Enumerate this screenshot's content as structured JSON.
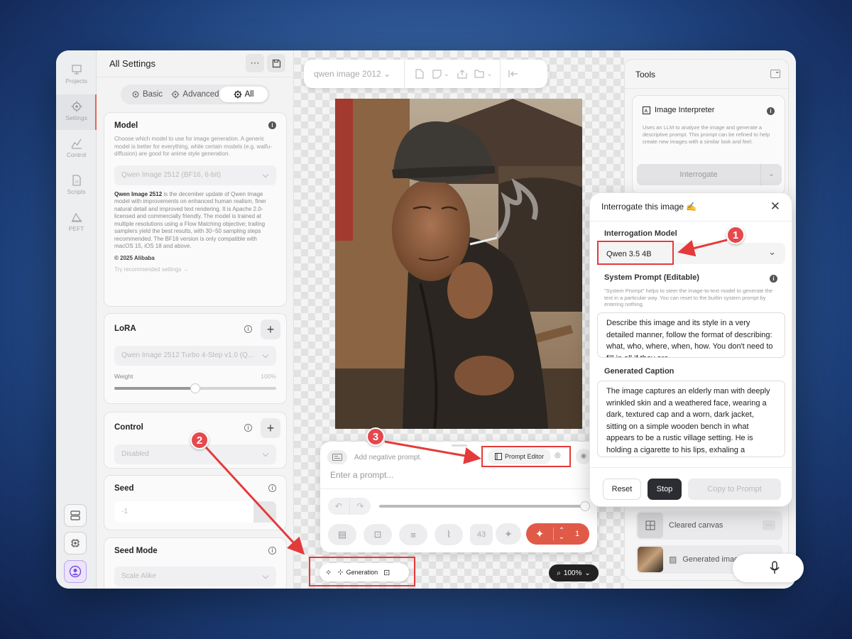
{
  "rail": {
    "items": [
      {
        "label": "Projects",
        "icon": "projects-icon"
      },
      {
        "label": "Settings",
        "icon": "settings-icon"
      },
      {
        "label": "Control",
        "icon": "control-icon"
      },
      {
        "label": "Scripts",
        "icon": "scripts-icon"
      },
      {
        "label": "PEFT",
        "icon": "peft-icon"
      }
    ],
    "active": "Settings"
  },
  "settings": {
    "title": "All Settings",
    "more_label": "⋯",
    "tabs": [
      {
        "label": "Basic"
      },
      {
        "label": "Advanced"
      },
      {
        "label": "All"
      }
    ],
    "active_tab": "All",
    "model": {
      "title": "Model",
      "description": "Choose which model to use for image generation. A generic model is better for everything, while certain models (e.g. waifu-diffusion) are good for anime style generation.",
      "value": "Qwen Image 2512 (BF16, 6-bit)",
      "detail_bold": "Qwen Image 2512",
      "detail_rest": " is the december update of Qwen Image model with improvements on enhanced human realism, finer natural detail and improved text rendering. It is Apache 2.0-licensed and commercially friendly. The model is trained at multiple resolutions using a Flow Matching objective; trailing samplers yield the best results, with 30~50 sampling steps recommended. The BF16 version is only compatible with macOS 15, iOS 18 and above.",
      "copyright": "© 2025 Alibaba",
      "recommend_link": "Try recommended settings →"
    },
    "lora": {
      "title": "LoRA",
      "value": "Qwen Image 2512 Turbo 4-Step v1.0 (Q...",
      "weight_label": "Weight",
      "weight_value": "100%",
      "weight_fraction": 0.5
    },
    "control": {
      "title": "Control",
      "value": "Disabled"
    },
    "seed": {
      "title": "Seed",
      "value": "-1"
    },
    "seed_mode": {
      "title": "Seed Mode",
      "value": "Scale Alike"
    }
  },
  "canvas": {
    "project_name": "qwen image 2012",
    "negative_prompt_placeholder": "Add negative prompt.",
    "prompt_editor_label": "Prompt Editor",
    "prompt_placeholder": "Enter a prompt...",
    "token_count": "43",
    "batch_count": "1",
    "mode_label": "Generation",
    "zoom": "100%",
    "photo_alt": "Elderly man in a cap smoking a cigarette in a village"
  },
  "tools": {
    "title": "Tools",
    "interpreter_title": "Image Interpreter",
    "interpreter_description": "Uses an LLM to analyze the image and generate a descriptive prompt. This prompt can be refined to help create new images with a similar look and feel.",
    "interrogate_label": "Interrogate",
    "history": [
      {
        "label": "Cleared canvas"
      },
      {
        "label": "Generated image"
      }
    ]
  },
  "popup": {
    "title": "Interrogate this image ✍️",
    "model_label": "Interrogation Model",
    "model_value": "Qwen 3.5 4B",
    "system_prompt_label": "System Prompt (Editable)",
    "system_prompt_help": "\"System Prompt\" helps to steer the image-to-text model to generate the text in a particular way. You can reset to the builtin system prompt by entering nothing.",
    "system_prompt_value": "Describe this image and its style in a very detailed manner, follow the format of describing: what, who, where, when, how. You don't need to fill in all if they are...",
    "caption_label": "Generated Caption",
    "caption_value": "The image captures an elderly man with deeply wrinkled skin and a weathered face, wearing a dark, textured cap and a worn, dark jacket, sitting on a simple wooden bench in what appears to be a rustic village setting. He is holding a cigarette to his lips, exhaling a",
    "reset_label": "Reset",
    "stop_label": "Stop",
    "copy_label": "Copy to Prompt"
  },
  "annotations": {
    "badge1": "1",
    "badge2": "2",
    "badge3": "3",
    "color": "#e53a3a"
  }
}
